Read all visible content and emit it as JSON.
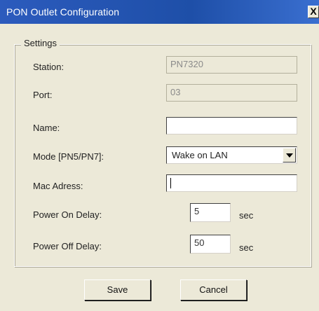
{
  "window": {
    "title": "PON Outlet Configuration",
    "close_label": "X"
  },
  "settings": {
    "legend": "Settings",
    "station_label": "Station:",
    "station_value": "PN7320",
    "port_label": "Port:",
    "port_value": "03",
    "name_label": "Name:",
    "name_value": "",
    "mode_label": "Mode [PN5/PN7]:",
    "mode_value": "Wake on LAN",
    "mac_label": "Mac Adress:",
    "mac_value": "",
    "power_on_label": "Power On Delay:",
    "power_on_value": "5",
    "power_on_unit": "sec",
    "power_off_label": "Power Off Delay:",
    "power_off_value": "50",
    "power_off_unit": "sec"
  },
  "buttons": {
    "save": "Save",
    "cancel": "Cancel"
  }
}
